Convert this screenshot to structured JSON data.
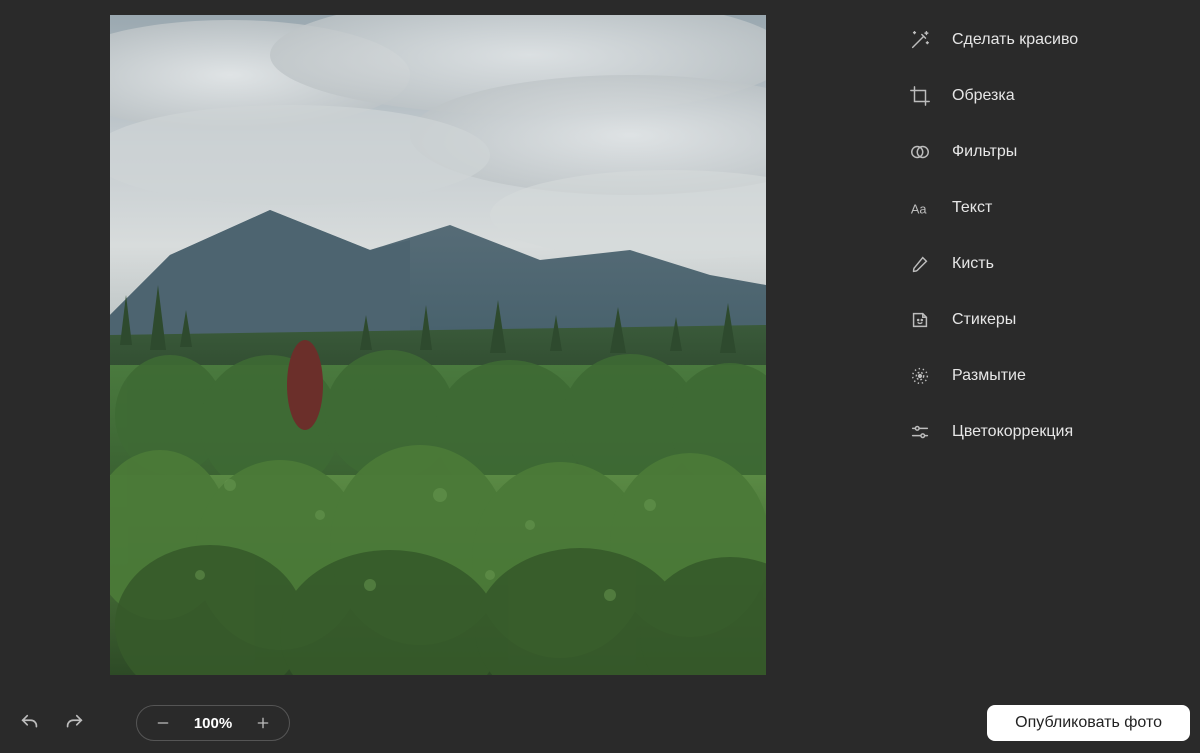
{
  "zoom": {
    "value": "100%"
  },
  "actions": {
    "publish": "Опубликовать фото"
  },
  "tools": [
    {
      "id": "enhance",
      "label": "Сделать красиво"
    },
    {
      "id": "crop",
      "label": "Обрезка"
    },
    {
      "id": "filters",
      "label": "Фильтры"
    },
    {
      "id": "text",
      "label": "Текст"
    },
    {
      "id": "brush",
      "label": "Кисть"
    },
    {
      "id": "stickers",
      "label": "Стикеры"
    },
    {
      "id": "blur",
      "label": "Размытие"
    },
    {
      "id": "color",
      "label": "Цветокоррекция"
    }
  ]
}
